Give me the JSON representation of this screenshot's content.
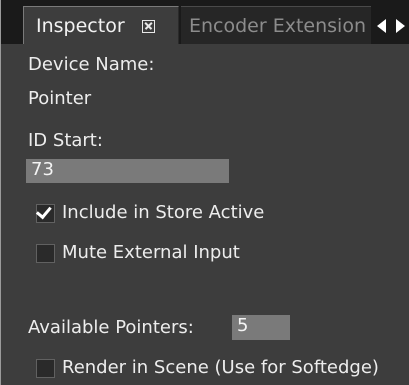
{
  "tabs": [
    {
      "label": "Inspector",
      "active": true
    },
    {
      "label": "Encoder Extension",
      "active": false
    }
  ],
  "icons": {
    "tab_close": "close-box-icon",
    "scroll_left": "triangle-left-icon",
    "scroll_right": "triangle-right-icon",
    "checkbox_check": "checkmark-icon"
  },
  "device_name": {
    "label": "Device Name:",
    "value": "Pointer"
  },
  "id_start": {
    "label": "ID Start:",
    "value": "73"
  },
  "include_store_active": {
    "label": "Include in Store Active",
    "checked": true
  },
  "mute_external_input": {
    "label": "Mute External Input",
    "checked": false
  },
  "available_pointers": {
    "label": "Available Pointers:",
    "value": "5"
  },
  "render_in_scene": {
    "label": "Render in Scene (Use for Softedge)",
    "checked": false
  },
  "colors": {
    "panel_background": "#3d3d3d",
    "tabstrip_background": "#1a1a1a",
    "field_background": "#7a7a7a",
    "text": "#ededed"
  }
}
